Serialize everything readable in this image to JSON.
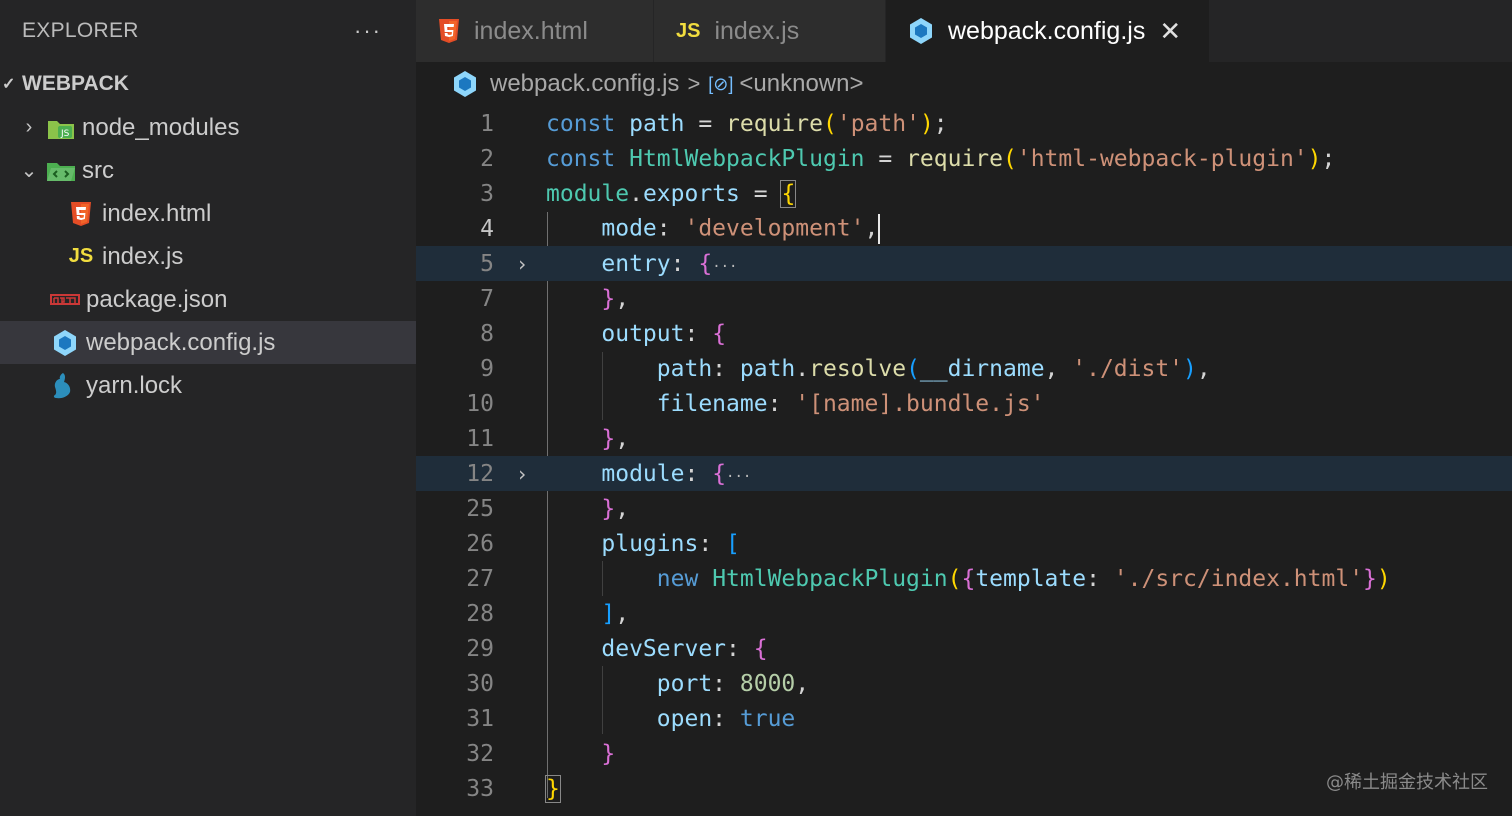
{
  "sidebar": {
    "title": "EXPLORER",
    "more": "···",
    "section": "WEBPACK",
    "items": [
      {
        "label": "node_modules",
        "icon": "node-modules-folder-icon"
      },
      {
        "label": "src",
        "icon": "src-folder-icon"
      },
      {
        "label": "index.html",
        "icon": "html5-icon"
      },
      {
        "label": "index.js",
        "icon": "js-icon"
      },
      {
        "label": "package.json",
        "icon": "npm-icon"
      },
      {
        "label": "webpack.config.js",
        "icon": "webpack-icon"
      },
      {
        "label": "yarn.lock",
        "icon": "yarn-icon"
      }
    ]
  },
  "tabs": [
    {
      "label": "index.html",
      "icon": "html5-icon"
    },
    {
      "label": "index.js",
      "icon": "js-icon",
      "icon_text": "JS"
    },
    {
      "label": "webpack.config.js",
      "icon": "webpack-icon",
      "close": "✕"
    }
  ],
  "breadcrumb": {
    "file": "webpack.config.js",
    "sep": ">",
    "symbol_icon": "[⊘]",
    "symbol": "<unknown>"
  },
  "line_numbers": [
    "1",
    "2",
    "3",
    "4",
    "5",
    "7",
    "8",
    "9",
    "10",
    "11",
    "12",
    "25",
    "26",
    "27",
    "28",
    "29",
    "30",
    "31",
    "32",
    "33"
  ],
  "code_strings": {
    "path_str": "'path'",
    "plugin_str": "'html-webpack-plugin'",
    "mode_val": "'development'",
    "dist_str": "'./dist'",
    "filename_str": "'[name].bundle.js'",
    "template_str": "'./src/index.html'",
    "port": "8000",
    "open": "true"
  },
  "watermark": "@稀土掘金技术社区",
  "colors": {
    "accent_keyword": "#569cd6",
    "string": "#ce9178",
    "class": "#4ec9b0",
    "function": "#dcdcaa"
  }
}
